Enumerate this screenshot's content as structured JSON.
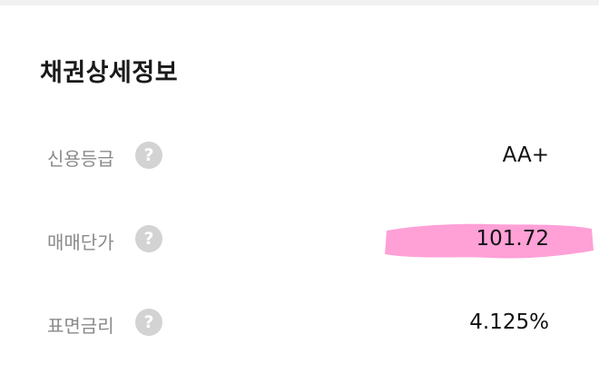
{
  "bond_detail": {
    "title": "채권상세정보",
    "rows": [
      {
        "label": "신용등급",
        "value": "AA+"
      },
      {
        "label": "매매단가",
        "value": "101.72"
      },
      {
        "label": "표면금리",
        "value": "4.125%"
      }
    ],
    "help_icon_glyph": "?",
    "highlight_color": "#ff8fd0"
  }
}
